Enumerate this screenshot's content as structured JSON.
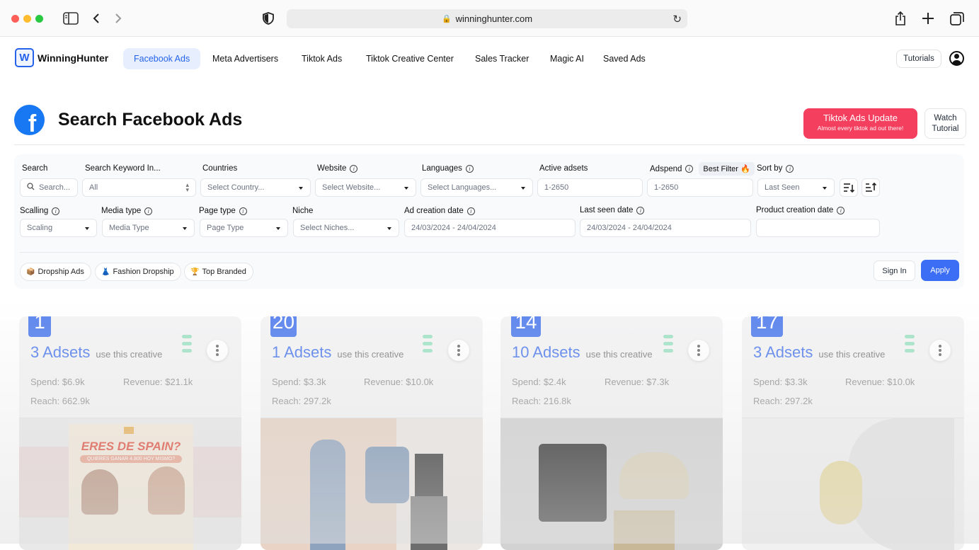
{
  "browser": {
    "url": "winninghunter.com"
  },
  "nav": {
    "logo_mark": "W",
    "logo_text": "WinningHunter",
    "items": [
      {
        "label": "Facebook Ads",
        "active": true
      },
      {
        "label": "Meta Advertisers"
      },
      {
        "label": "Tiktok Ads"
      },
      {
        "label": "Tiktok Creative Center"
      },
      {
        "label": "Sales Tracker"
      },
      {
        "label": "Magic AI"
      },
      {
        "label": "Saved Ads"
      }
    ],
    "tutorials": "Tutorials"
  },
  "header": {
    "title": "Search Facebook Ads",
    "fb_letter": "f",
    "tiktok_btn": "Tiktok Ads Update",
    "tiktok_sub": "Almost every tiktok ad out there!",
    "watch_line1": "Watch",
    "watch_line2": "Tutorial"
  },
  "filters": {
    "search_label": "Search",
    "search_placeholder": "Search...",
    "keyword_label": "Search Keyword In...",
    "keyword_value": "All",
    "countries_label": "Countries",
    "countries_value": "Select Country...",
    "website_label": "Website",
    "website_value": "Select Website...",
    "languages_label": "Languages",
    "languages_value": "Select Languages...",
    "active_label": "Active adsets",
    "active_value": "1-2650",
    "adspend_label": "Adspend",
    "best_filter": "Best Filter 🔥",
    "adspend_value": "1-2650",
    "sortby_label": "Sort by",
    "sortby_value": "Last Seen",
    "scalling_label": "Scalling",
    "scalling_value": "Scaling",
    "media_label": "Media type",
    "media_value": "Media Type",
    "pagetype_label": "Page type",
    "pagetype_value": "Page Type",
    "niche_label": "Niche",
    "niche_value": "Select Niches...",
    "adcreation_label": "Ad creation date",
    "adcreation_value": "24/03/2024 - 24/04/2024",
    "lastseen_label": "Last seen date",
    "lastseen_value": "24/03/2024 - 24/04/2024",
    "productcreation_label": "Product creation date",
    "productcreation_value": "",
    "info_glyph": "i"
  },
  "chips": [
    {
      "emoji": "📦",
      "label": "Dropship Ads"
    },
    {
      "emoji": "👗",
      "label": "Fashion Dropship"
    },
    {
      "emoji": "🏆",
      "label": "Top Branded"
    }
  ],
  "actions": {
    "signin": "Sign In",
    "apply": "Apply"
  },
  "cards": [
    {
      "rank": "1",
      "adsets": "3 Adsets",
      "suffix": "use this creative",
      "spend": "Spend: $6.9k",
      "revenue": "Revenue: $21.1k",
      "reach": "Reach: 662.9k",
      "media_caption": "ERES DE SPAIN?",
      "media_sub": "QUIERES GANAR 4.800 HOY MISMO?"
    },
    {
      "rank": "20",
      "adsets": "1 Adsets",
      "suffix": "use this creative",
      "spend": "Spend: $3.3k",
      "revenue": "Revenue: $10.0k",
      "reach": "Reach: 297.2k"
    },
    {
      "rank": "14",
      "adsets": "10 Adsets",
      "suffix": "use this creative",
      "spend": "Spend: $2.4k",
      "revenue": "Revenue: $7.3k",
      "reach": "Reach: 216.8k"
    },
    {
      "rank": "17",
      "adsets": "3 Adsets",
      "suffix": "use this creative",
      "spend": "Spend: $3.3k",
      "revenue": "Revenue: $10.0k",
      "reach": "Reach: 297.2k"
    }
  ],
  "colors": {
    "accent": "#3b6ef5",
    "rank_badge": "#5d86ee",
    "tiktok_btn": "#f43f5e",
    "facebook": "#1877f2",
    "bars": "#a7e4c9"
  }
}
